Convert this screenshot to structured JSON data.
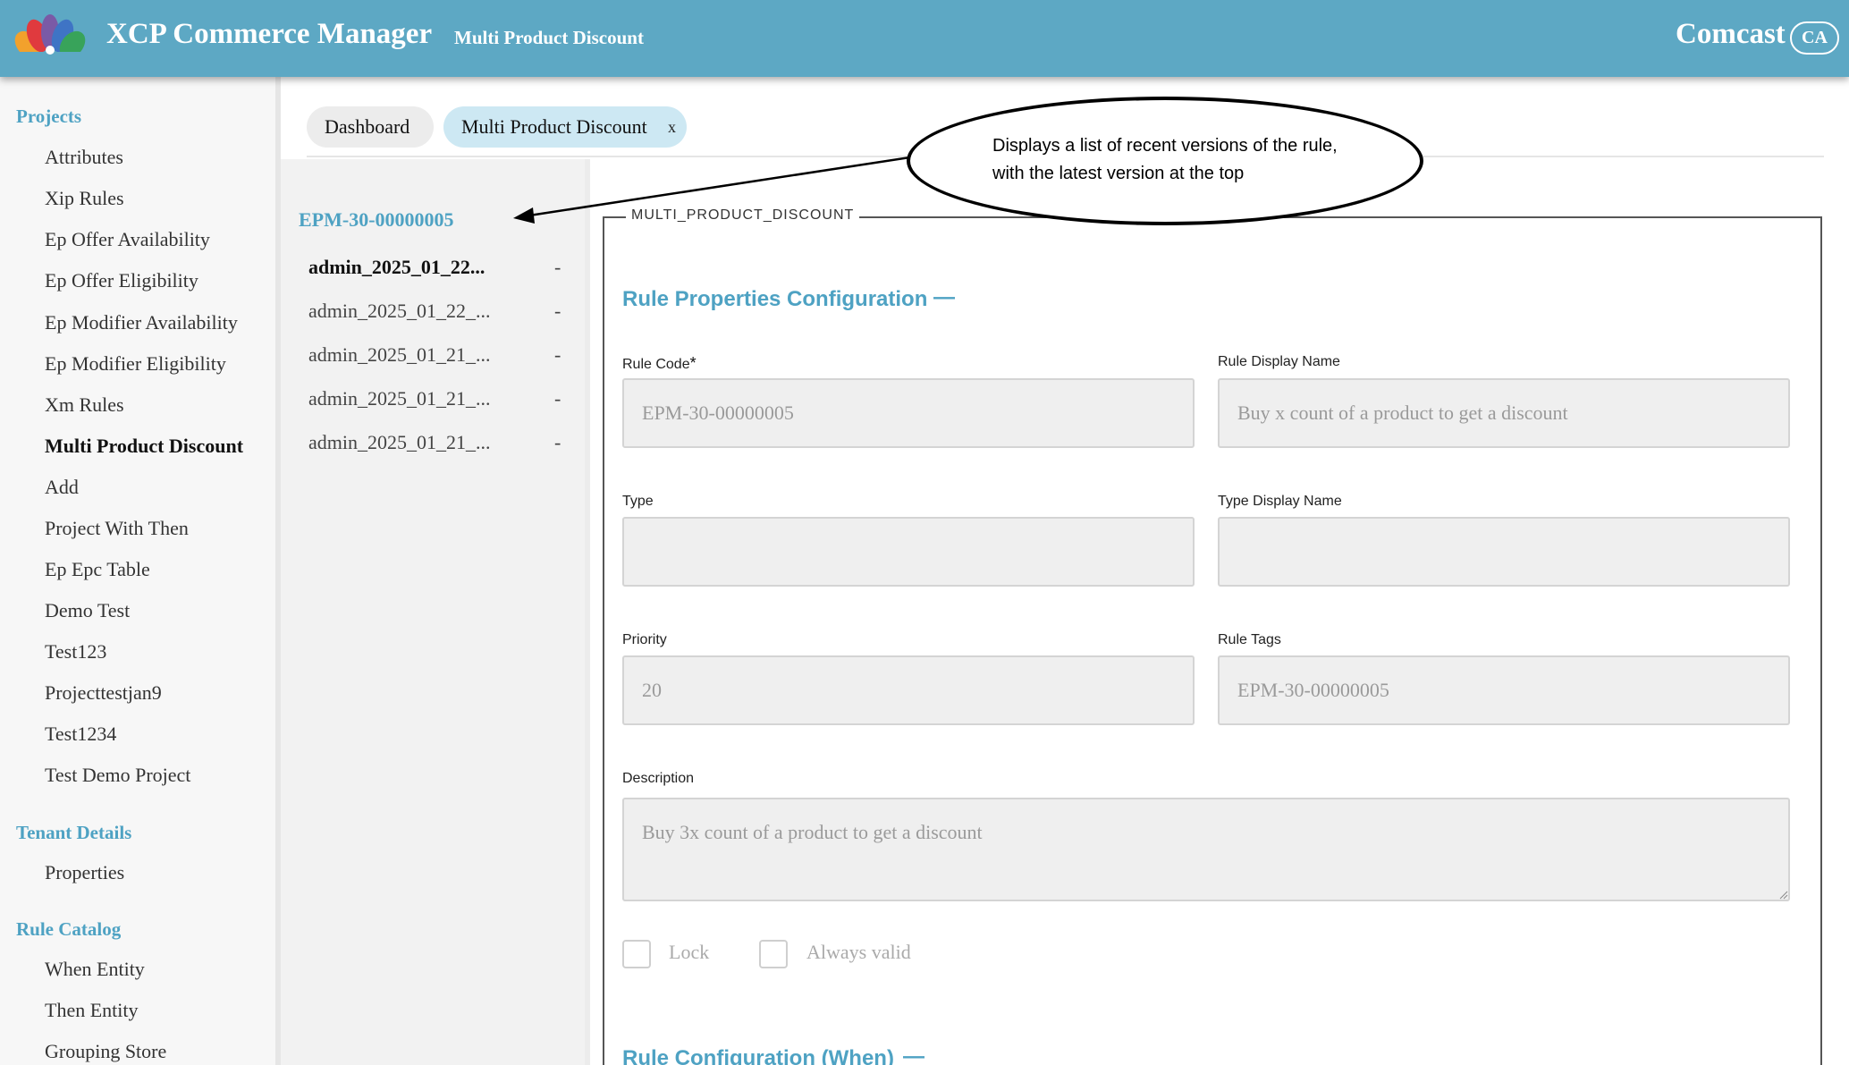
{
  "header": {
    "app_title": "XCP Commerce Manager",
    "subtitle": "Multi Product Discount",
    "brand": "Comcast",
    "avatar": "CA",
    "logo_icon": "peacock-logo-icon"
  },
  "sidebar": {
    "sections": [
      {
        "title": "Projects",
        "items": [
          "Attributes",
          "Xip Rules",
          "Ep Offer Availability",
          "Ep Offer Eligibility",
          "Ep Modifier Availability",
          "Ep Modifier Eligibility",
          "Xm Rules",
          "Multi Product Discount",
          "Add",
          "Project With Then",
          "Ep Epc Table",
          "Demo Test",
          "Test123",
          "Projecttestjan9",
          "Test1234",
          "Test Demo Project"
        ]
      },
      {
        "title": "Tenant Details",
        "items": [
          "Properties"
        ]
      },
      {
        "title": "Rule Catalog",
        "items": [
          "When Entity",
          "Then Entity",
          "Grouping Store"
        ]
      }
    ],
    "active_item": "Multi Product Discount"
  },
  "tabs": [
    {
      "label": "Dashboard",
      "closable": false
    },
    {
      "label": "Multi Product Discount",
      "closable": true,
      "close_glyph": "x"
    }
  ],
  "versions": {
    "rule_code": "EPM-30-00000005",
    "items": [
      {
        "label": "admin_2025_01_22...",
        "marker": "-",
        "latest": true
      },
      {
        "label": "admin_2025_01_22_...",
        "marker": "-",
        "latest": false
      },
      {
        "label": "admin_2025_01_21_...",
        "marker": "-",
        "latest": false
      },
      {
        "label": "admin_2025_01_21_...",
        "marker": "-",
        "latest": false
      },
      {
        "label": "admin_2025_01_21_...",
        "marker": "-",
        "latest": false
      }
    ]
  },
  "annotation": {
    "text": "Displays a list of recent versions of the rule, with the latest version at the top"
  },
  "form": {
    "legend": "MULTI_PRODUCT_DISCOUNT",
    "section_title": "Rule Properties Configuration",
    "section_toggle": "—",
    "fields": {
      "rule_code": {
        "label": "Rule Code",
        "required_mark": "*",
        "value": "EPM-30-00000005"
      },
      "rule_display_name": {
        "label": "Rule Display Name",
        "value": "Buy x count of a product to get a discount"
      },
      "type": {
        "label": "Type",
        "value": ""
      },
      "type_display_name": {
        "label": "Type Display Name",
        "value": ""
      },
      "priority": {
        "label": "Priority",
        "value": "20"
      },
      "rule_tags": {
        "label": "Rule Tags",
        "value": "EPM-30-00000005"
      },
      "description": {
        "label": "Description",
        "value": "Buy 3x count of a product to get a discount"
      }
    },
    "checkboxes": [
      {
        "label": "Lock",
        "checked": false
      },
      {
        "label": "Always valid",
        "checked": false
      }
    ],
    "next_section_title": "Rule Configuration (When)",
    "next_section_toggle": "—"
  },
  "colors": {
    "header": "#5da8c4",
    "accent": "#4ea2c3",
    "active_tab": "#cde8f3"
  }
}
